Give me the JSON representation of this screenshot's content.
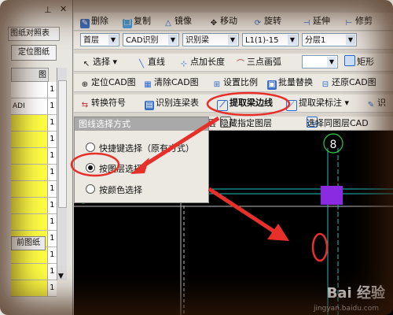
{
  "left_panel": {
    "pin_icon": "pin-icon",
    "close_icon": "close-icon",
    "tab_label": "图纸对照表",
    "locate_button": "定位图纸",
    "header_num": "图",
    "rows": [
      {
        "name": "",
        "num": "1",
        "yellow": false
      },
      {
        "name": "ADI",
        "num": "1",
        "yellow": false
      },
      {
        "name": "",
        "num": "1",
        "yellow": true
      },
      {
        "name": "",
        "num": "1",
        "yellow": true
      },
      {
        "name": "",
        "num": "1",
        "yellow": true
      },
      {
        "name": "",
        "num": "1",
        "yellow": true
      },
      {
        "name": "",
        "num": "1",
        "yellow": true
      },
      {
        "name": "",
        "num": "1",
        "yellow": true
      },
      {
        "name": "",
        "num": "1",
        "yellow": true
      },
      {
        "name": "",
        "num": "1",
        "yellow": true
      },
      {
        "name": "",
        "num": "1",
        "yellow": true
      },
      {
        "name": "",
        "num": "1",
        "yellow": true
      },
      {
        "name": "",
        "num": "1",
        "yellow": true
      }
    ],
    "current_button": "前图纸"
  },
  "toolbar1": {
    "delete": "删除",
    "copy": "复制",
    "mirror": "镜像",
    "move": "移动",
    "rotate": "旋转",
    "extend": "延伸",
    "trim": "修剪"
  },
  "toolbar2": {
    "floor": "首层",
    "cad_identify": "CAD识别",
    "identify_beam": "识别梁",
    "beam_type": "L1(1)-15",
    "layer": "分层1"
  },
  "toolbar3": {
    "select": "选择",
    "line": "直线",
    "point_length": "点加长度",
    "three_point_arc": "三点画弧",
    "rect": "矩形"
  },
  "toolbar4": {
    "locate_cad": "定位CAD图",
    "clear_cad": "清除CAD图",
    "set_scale": "设置比例",
    "batch_replace": "批量替换",
    "restore_cad": "还原CAD图"
  },
  "toolbar5": {
    "convert_symbol": "转换符号",
    "identify_beam_table": "识别连梁表",
    "extract_beam_edge": "提取梁边线",
    "extract_beam_label": "提取梁标注",
    "more": "识"
  },
  "canvas_bar": {
    "layer_suffix": "层",
    "hide_layer": "隐藏指定图层",
    "select_same": "选择同图层CAD"
  },
  "popup": {
    "title": "图线选择方式",
    "opt1": "快捷键选择（原有方式）",
    "opt2": "按图层选择",
    "opt3": "按颜色选择"
  },
  "canvas": {
    "axis_number": "8"
  },
  "watermark": {
    "brand": "Bai 经验",
    "url": "jingyan.baidu.com"
  },
  "colors": {
    "annotation_red": "#e8302a",
    "purple_block": "#8a2be2",
    "cyan_line": "#20c0c0",
    "green_circle": "#2ecc40"
  }
}
